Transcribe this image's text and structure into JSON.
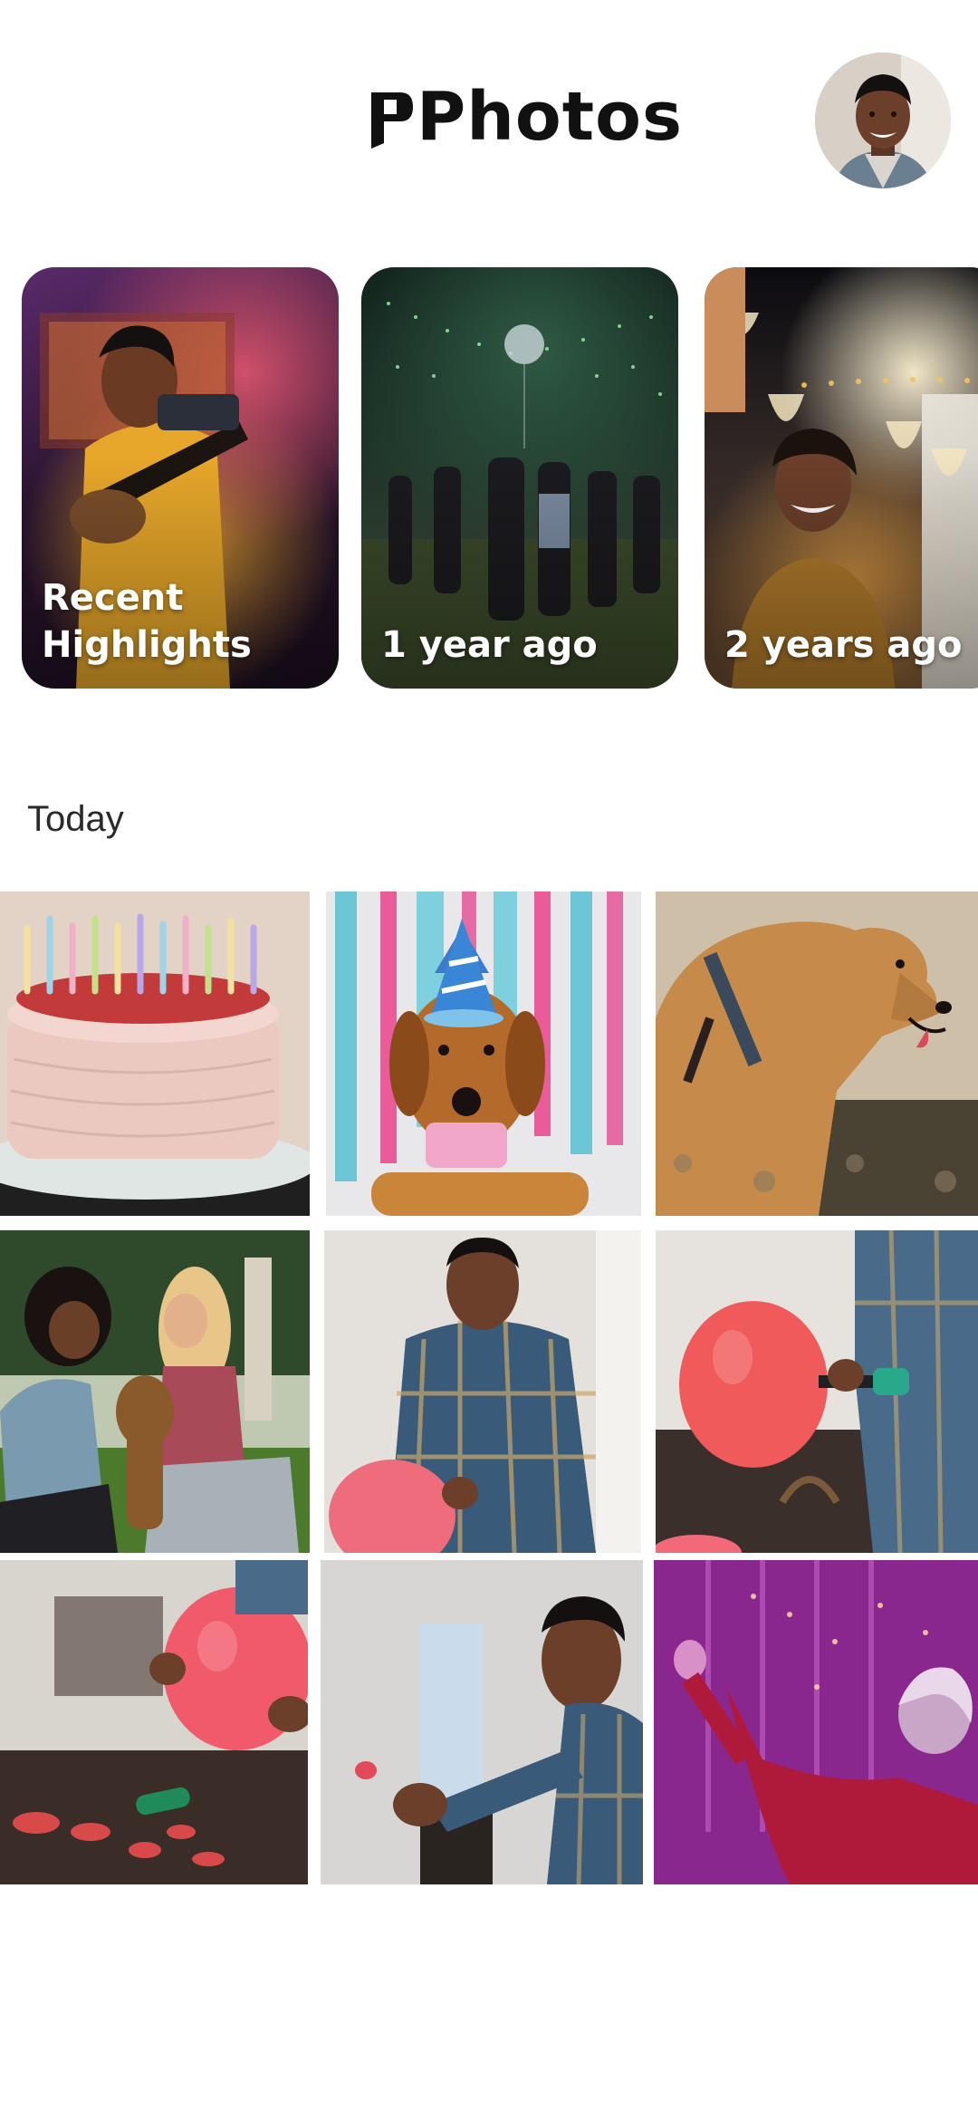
{
  "header": {
    "title": "Photos",
    "avatar_icon": "user-avatar"
  },
  "memories": [
    {
      "label": "Recent Highlights"
    },
    {
      "label": "1 year ago"
    },
    {
      "label": "2 years ago"
    }
  ],
  "section": {
    "title": "Today"
  },
  "photos": [
    {
      "subject": "birthday-cake"
    },
    {
      "subject": "dog-party-hat"
    },
    {
      "subject": "dog-profile"
    },
    {
      "subject": "couple-with-dog"
    },
    {
      "subject": "man-balloon"
    },
    {
      "subject": "balloon-pump"
    },
    {
      "subject": "hands-balloon"
    },
    {
      "subject": "man-smiling"
    },
    {
      "subject": "woman-confetti"
    }
  ]
}
